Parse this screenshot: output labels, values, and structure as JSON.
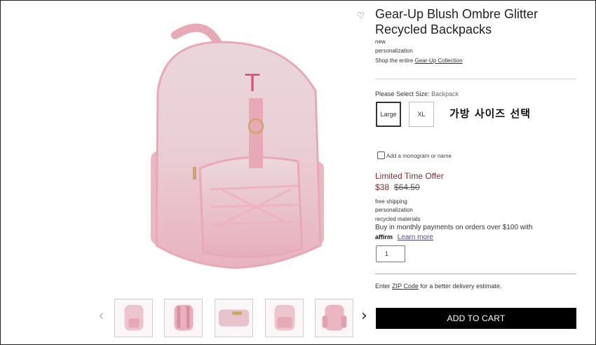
{
  "product": {
    "title": "Gear-Up Blush Ombre Glitter Recycled Backpacks",
    "tags": [
      "new",
      "personalization"
    ],
    "collection_prefix": "Shop the entire",
    "collection_link": "Gear-Up Collection"
  },
  "size": {
    "prompt_label": "Please Select Size:",
    "selected_value": "Backpack",
    "options": [
      "Large",
      "XL"
    ],
    "selected_option": "Large",
    "korean_annotation": "가방 사이즈 선택"
  },
  "monogram": {
    "label": "Add a monogram or name"
  },
  "pricing": {
    "offer_label": "Limited Time Offer",
    "sale_price": "$38",
    "original_price": "$64.50"
  },
  "features": [
    "free shipping",
    "personalization",
    "recycled materials"
  ],
  "affirm": {
    "text": "Buy in monthly payments on orders over $100 with",
    "logo": "affirm",
    "learn_more": "Learn more"
  },
  "quantity": {
    "value": "1"
  },
  "delivery": {
    "prefix": "Enter",
    "link": "ZIP Code",
    "suffix": "for a better delivery estimate."
  },
  "cart": {
    "button_label": "ADD TO CART"
  },
  "gallery": {
    "prev_icon": "chevron-left-icon",
    "next_icon": "chevron-right-icon",
    "monogram_letter": "T",
    "thumbnail_count": 5
  },
  "colors": {
    "blush_pink": "#e9a9b6",
    "glitter": "#f2dde2",
    "price_red": "#8b2a2a",
    "cart_black": "#000000"
  }
}
